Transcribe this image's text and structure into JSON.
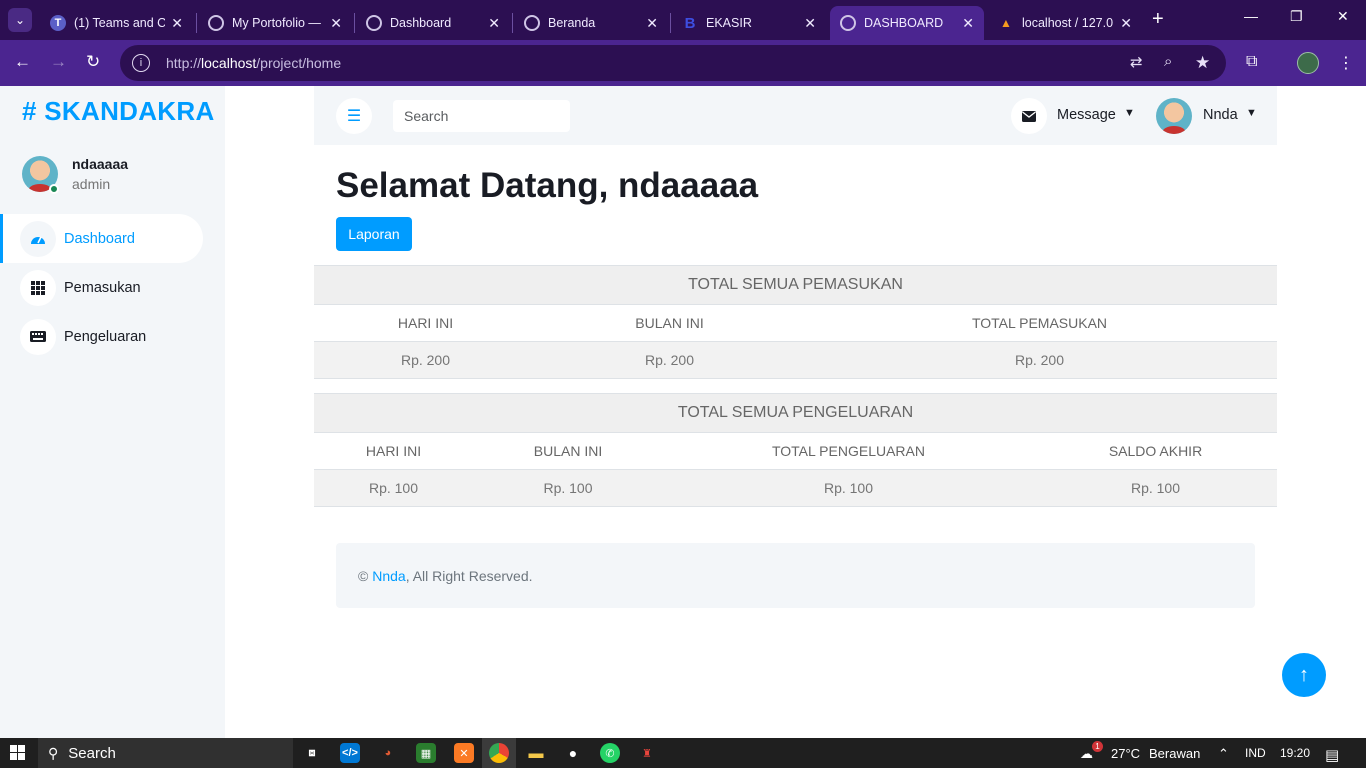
{
  "browser": {
    "tabs": [
      {
        "label": "(1) Teams and Ch",
        "icon": "teams-icon",
        "active": false
      },
      {
        "label": "My Portofolio —",
        "icon": "globe-icon",
        "active": false
      },
      {
        "label": "Dashboard",
        "icon": "globe-icon",
        "active": false
      },
      {
        "label": "Beranda",
        "icon": "globe-icon",
        "active": false
      },
      {
        "label": "EKASIR",
        "icon": "bootstrap-icon",
        "active": false
      },
      {
        "label": "DASHBOARD",
        "icon": "globe-icon",
        "active": true
      },
      {
        "label": "localhost / 127.0",
        "icon": "phpmyadmin-icon",
        "active": false
      }
    ],
    "url_prefix": "http://",
    "url_host": "localhost",
    "url_path": "/project/home"
  },
  "sidebar": {
    "brand": "# SKANDAKRA",
    "user_name": "ndaaaaa",
    "user_role": "admin",
    "items": [
      {
        "label": "Dashboard",
        "icon": "tachometer-icon",
        "active": true
      },
      {
        "label": "Pemasukan",
        "icon": "grid-icon",
        "active": false
      },
      {
        "label": "Pengeluaran",
        "icon": "keyboard-icon",
        "active": false
      }
    ]
  },
  "topbar": {
    "search_placeholder": "Search",
    "message_label": "Message",
    "user_label": "Nnda"
  },
  "main": {
    "welcome": "Selamat Datang, ndaaaaa",
    "report_button": "Laporan",
    "income": {
      "title": "TOTAL SEMUA PEMASUKAN",
      "columns": [
        "HARI INI",
        "BULAN INI",
        "TOTAL PEMASUKAN"
      ],
      "values": [
        "Rp. 200",
        "Rp. 200",
        "Rp. 200"
      ]
    },
    "expense": {
      "title": "TOTAL SEMUA PENGELUARAN",
      "columns": [
        "HARI INI",
        "BULAN INI",
        "TOTAL PENGELUARAN",
        "SALDO AKHIR"
      ],
      "values": [
        "Rp. 100",
        "Rp. 100",
        "Rp. 100",
        "Rp. 100"
      ]
    }
  },
  "footer": {
    "copyright": "©",
    "link": "Nnda",
    "rest": ", All Right Reserved."
  },
  "taskbar": {
    "search": "Search",
    "weather": "27°C",
    "weather_desc": "Berawan",
    "weather_badge": "1",
    "language": "IND",
    "time": "19:20"
  },
  "colors": {
    "accent": "#009cff",
    "sidebar_bg": "#f3f6f9",
    "browser_bg": "#2c0f52",
    "address_bg": "#4b2590"
  }
}
